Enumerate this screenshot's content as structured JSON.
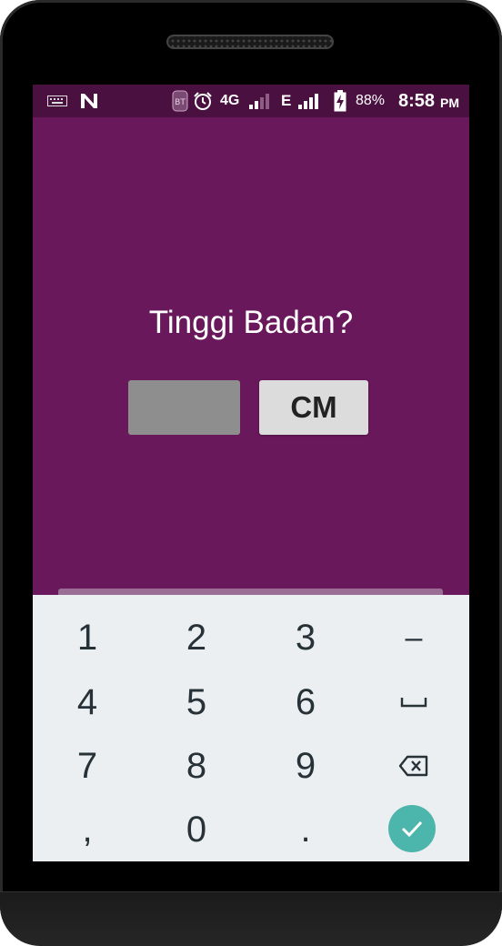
{
  "status_bar": {
    "icons": [
      "keyboard-icon",
      "n-icon",
      "bt-icon",
      "alarm-icon",
      "signal-icon",
      "signal-icon",
      "battery-charging-icon"
    ],
    "network_4g": "4G",
    "network_e": "E",
    "battery": "88%",
    "time": "8:58",
    "ampm": "PM"
  },
  "main": {
    "title": "Tinggi Badan?",
    "height_input_value": "",
    "unit_button": "CM"
  },
  "keyboard": {
    "keys": [
      "1",
      "2",
      "3",
      "–",
      "4",
      "5",
      "6",
      "␣",
      "7",
      "8",
      "9",
      "backspace",
      ",",
      "0",
      ".",
      "done"
    ],
    "key_1": "1",
    "key_2": "2",
    "key_3": "3",
    "key_minus": "–",
    "key_4": "4",
    "key_5": "5",
    "key_6": "6",
    "key_7": "7",
    "key_8": "8",
    "key_9": "9",
    "key_comma": ",",
    "key_0": "0",
    "key_period": "."
  },
  "colors": {
    "app_background": "#69195b",
    "status_bar": "#4a1040",
    "input_box": "#8e8e8e",
    "unit_button": "#dcdcdc",
    "keyboard_background": "#eceff1",
    "done_button": "#4db6ac"
  }
}
